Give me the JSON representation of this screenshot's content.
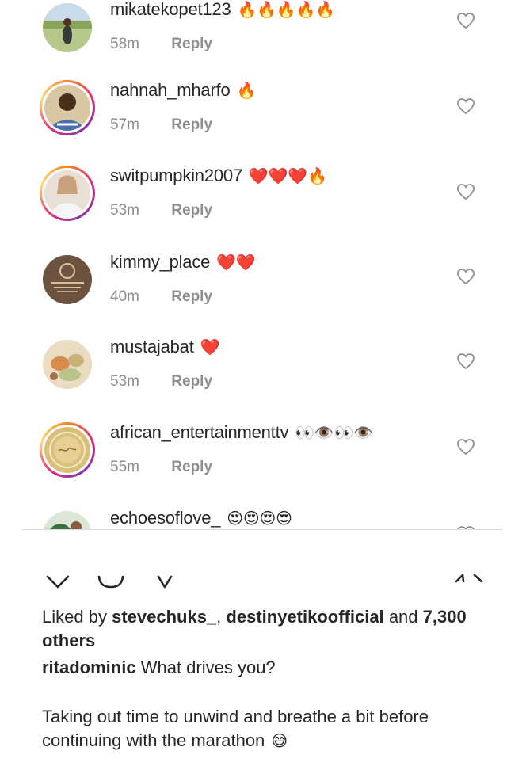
{
  "comments": [
    {
      "username": "mikatekopet123",
      "emoji": "🔥🔥🔥🔥🔥",
      "time": "58m",
      "reply": "Reply",
      "ring": false,
      "avatar": "person-outdoor"
    },
    {
      "username": "nahnah_mharfo",
      "emoji": "🔥",
      "time": "57m",
      "reply": "Reply",
      "ring": true,
      "avatar": "person-dark"
    },
    {
      "username": "switpumpkin2007",
      "emoji": "❤️❤️❤️🔥",
      "time": "53m",
      "reply": "Reply",
      "ring": true,
      "avatar": "person-light"
    },
    {
      "username": "kimmy_place",
      "emoji": "❤️❤️",
      "time": "40m",
      "reply": "Reply",
      "ring": false,
      "avatar": "logo-kimmy"
    },
    {
      "username": "mustajabat",
      "emoji": "❤️",
      "time": "53m",
      "reply": "Reply",
      "ring": false,
      "avatar": "food"
    },
    {
      "username": "african_entertainmenttv",
      "emoji": "👀👁️👀👁️",
      "time": "55m",
      "reply": "Reply",
      "ring": true,
      "avatar": "logo-gold"
    },
    {
      "username": "echoesoflove_",
      "emoji": "😍😍😍😍",
      "time": "",
      "reply": "",
      "ring": false,
      "avatar": "person-green"
    }
  ],
  "actions": {
    "icons": [
      "heart-icon",
      "comment-icon",
      "share-icon",
      "bookmark-icon"
    ]
  },
  "post": {
    "liked_by_prefix": "Liked by",
    "liked_user_1": "stevechuks_",
    "liked_user_2": "destinyetikoofficial",
    "liked_and": "and",
    "liked_count": "7,300 others",
    "author": "ritadominic",
    "caption_question": "What drives you?",
    "caption_body": "Taking out time to unwind and breathe a bit before continuing with the marathon",
    "caption_emoji": "😅"
  },
  "colors": {
    "text": "#262626",
    "secondary": "#8e8e8e",
    "story_ring": "#dd2a7b"
  }
}
